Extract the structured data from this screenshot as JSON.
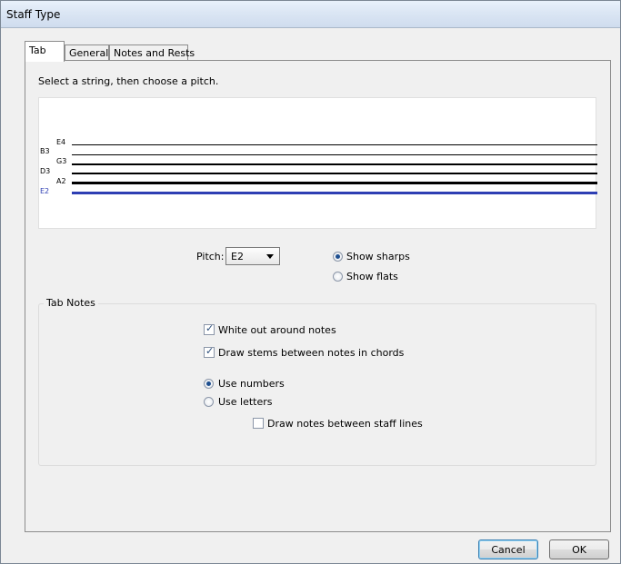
{
  "window": {
    "title": "Staff Type"
  },
  "tabs": [
    {
      "label": "Tab",
      "active": true
    },
    {
      "label": "General",
      "active": false
    },
    {
      "label": "Notes and Rests",
      "active": false
    }
  ],
  "tab_content": {
    "instruction": "Select a string, then choose a pitch.",
    "strings": [
      {
        "label": "E4"
      },
      {
        "label": "B3"
      },
      {
        "label": "G3"
      },
      {
        "label": "D3"
      },
      {
        "label": "A2"
      },
      {
        "label": "E2",
        "selected": true
      }
    ],
    "selected_color": "#2e3eb3",
    "pitch": {
      "label": "Pitch:",
      "value": "E2",
      "show_sharps": {
        "label": "Show sharps",
        "checked": true
      },
      "show_flats": {
        "label": "Show flats",
        "checked": false
      }
    },
    "tab_notes": {
      "title": "Tab Notes",
      "white_out": {
        "label": "White out around notes",
        "checked": true
      },
      "draw_stems": {
        "label": "Draw stems between notes in chords",
        "checked": true
      },
      "use_numbers": {
        "label": "Use numbers",
        "checked": true
      },
      "use_letters": {
        "label": "Use letters",
        "checked": false
      },
      "draw_between": {
        "label": "Draw notes between staff lines",
        "checked": false
      }
    }
  },
  "buttons": {
    "cancel": "Cancel",
    "ok": "OK"
  }
}
